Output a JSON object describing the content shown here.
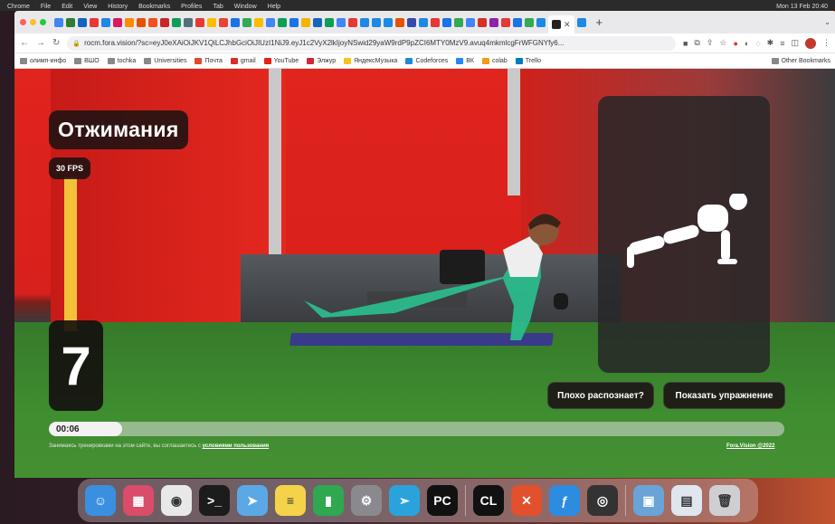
{
  "menubar": {
    "app": "Chrome",
    "items": [
      "File",
      "Edit",
      "View",
      "History",
      "Bookmarks",
      "Profiles",
      "Tab",
      "Window",
      "Help"
    ],
    "clock": "Mon 13 Feb 20:40"
  },
  "browser": {
    "active_tab_icon": "fora-vision-icon",
    "url": "rocm.fora.vision/?sc=eyJ0eXAiOiJKV1QiLCJhbGciOiJIUzI1NiJ9.eyJ1c2VyX2lkIjoyNSwid29yaW9rdP9pZCI6MTY0MzV9.avuq4mkmlcgFrWFGNYfy6...",
    "bookmarks": [
      {
        "label": "олимп-инфо",
        "color": "#888"
      },
      {
        "label": "ВШО",
        "color": "#888"
      },
      {
        "label": "tochka",
        "color": "#888"
      },
      {
        "label": "Universities",
        "color": "#888"
      },
      {
        "label": "Почта",
        "color": "#e04a2a"
      },
      {
        "label": "gmail",
        "color": "#d93025"
      },
      {
        "label": "YouTube",
        "color": "#e62117"
      },
      {
        "label": "Элжур",
        "color": "#d3263a"
      },
      {
        "label": "ЯндексМузыка",
        "color": "#f4c21c"
      },
      {
        "label": "Codeforces",
        "color": "#1f8ad1"
      },
      {
        "label": "ВК",
        "color": "#2787f5"
      },
      {
        "label": "colab",
        "color": "#f29b1b"
      },
      {
        "label": "Trello",
        "color": "#0079bf"
      }
    ],
    "other_bookmarks": "Other Bookmarks"
  },
  "app": {
    "exercise_title": "Отжимания",
    "fps": "30 FPS",
    "rep_count": "7",
    "timer": "00:06",
    "progress": 0.1,
    "bad_recognition_button": "Плохо распознает?",
    "show_exercise_button": "Показать упражнение",
    "terms_text": "Занимаясь тренировками на этом сайте, вы соглашаетесь с",
    "terms_link": "условиями пользования",
    "brand": "Fora.Vision @2022"
  },
  "dock": [
    {
      "name": "finder-icon",
      "color": "#3b8fe0",
      "glyph": "☺"
    },
    {
      "name": "launchpad-icon",
      "color": "#d94c6a",
      "glyph": "▦"
    },
    {
      "name": "chrome-icon",
      "color": "#e8e8e8",
      "glyph": "◉"
    },
    {
      "name": "terminal-icon",
      "color": "#1c1c1c",
      "glyph": ">_"
    },
    {
      "name": "maps-icon",
      "color": "#5aa9e6",
      "glyph": "➤"
    },
    {
      "name": "notes-icon",
      "color": "#f4d34a",
      "glyph": "≡"
    },
    {
      "name": "numbers-icon",
      "color": "#2fa84f",
      "glyph": "▮"
    },
    {
      "name": "system-preferences-icon",
      "color": "#8a8a8e",
      "glyph": "⚙"
    },
    {
      "name": "telegram-icon",
      "color": "#2aa3dd",
      "glyph": "➣"
    },
    {
      "name": "pycharm-icon",
      "color": "#111",
      "glyph": "PC"
    },
    {
      "name": "clion-icon",
      "color": "#111",
      "glyph": "CL"
    },
    {
      "name": "xmind-icon",
      "color": "#e2502d",
      "glyph": "✕"
    },
    {
      "name": "skiff-icon",
      "color": "#2c8de0",
      "glyph": "ƒ"
    },
    {
      "name": "obs-icon",
      "color": "#333",
      "glyph": "◎"
    },
    {
      "name": "preview-icon",
      "color": "#6aa3d6",
      "glyph": "▣"
    },
    {
      "name": "documents-icon",
      "color": "#dfe6ee",
      "glyph": "▤"
    },
    {
      "name": "trash-icon",
      "color": "#cfcfd3",
      "glyph": "🗑"
    }
  ]
}
